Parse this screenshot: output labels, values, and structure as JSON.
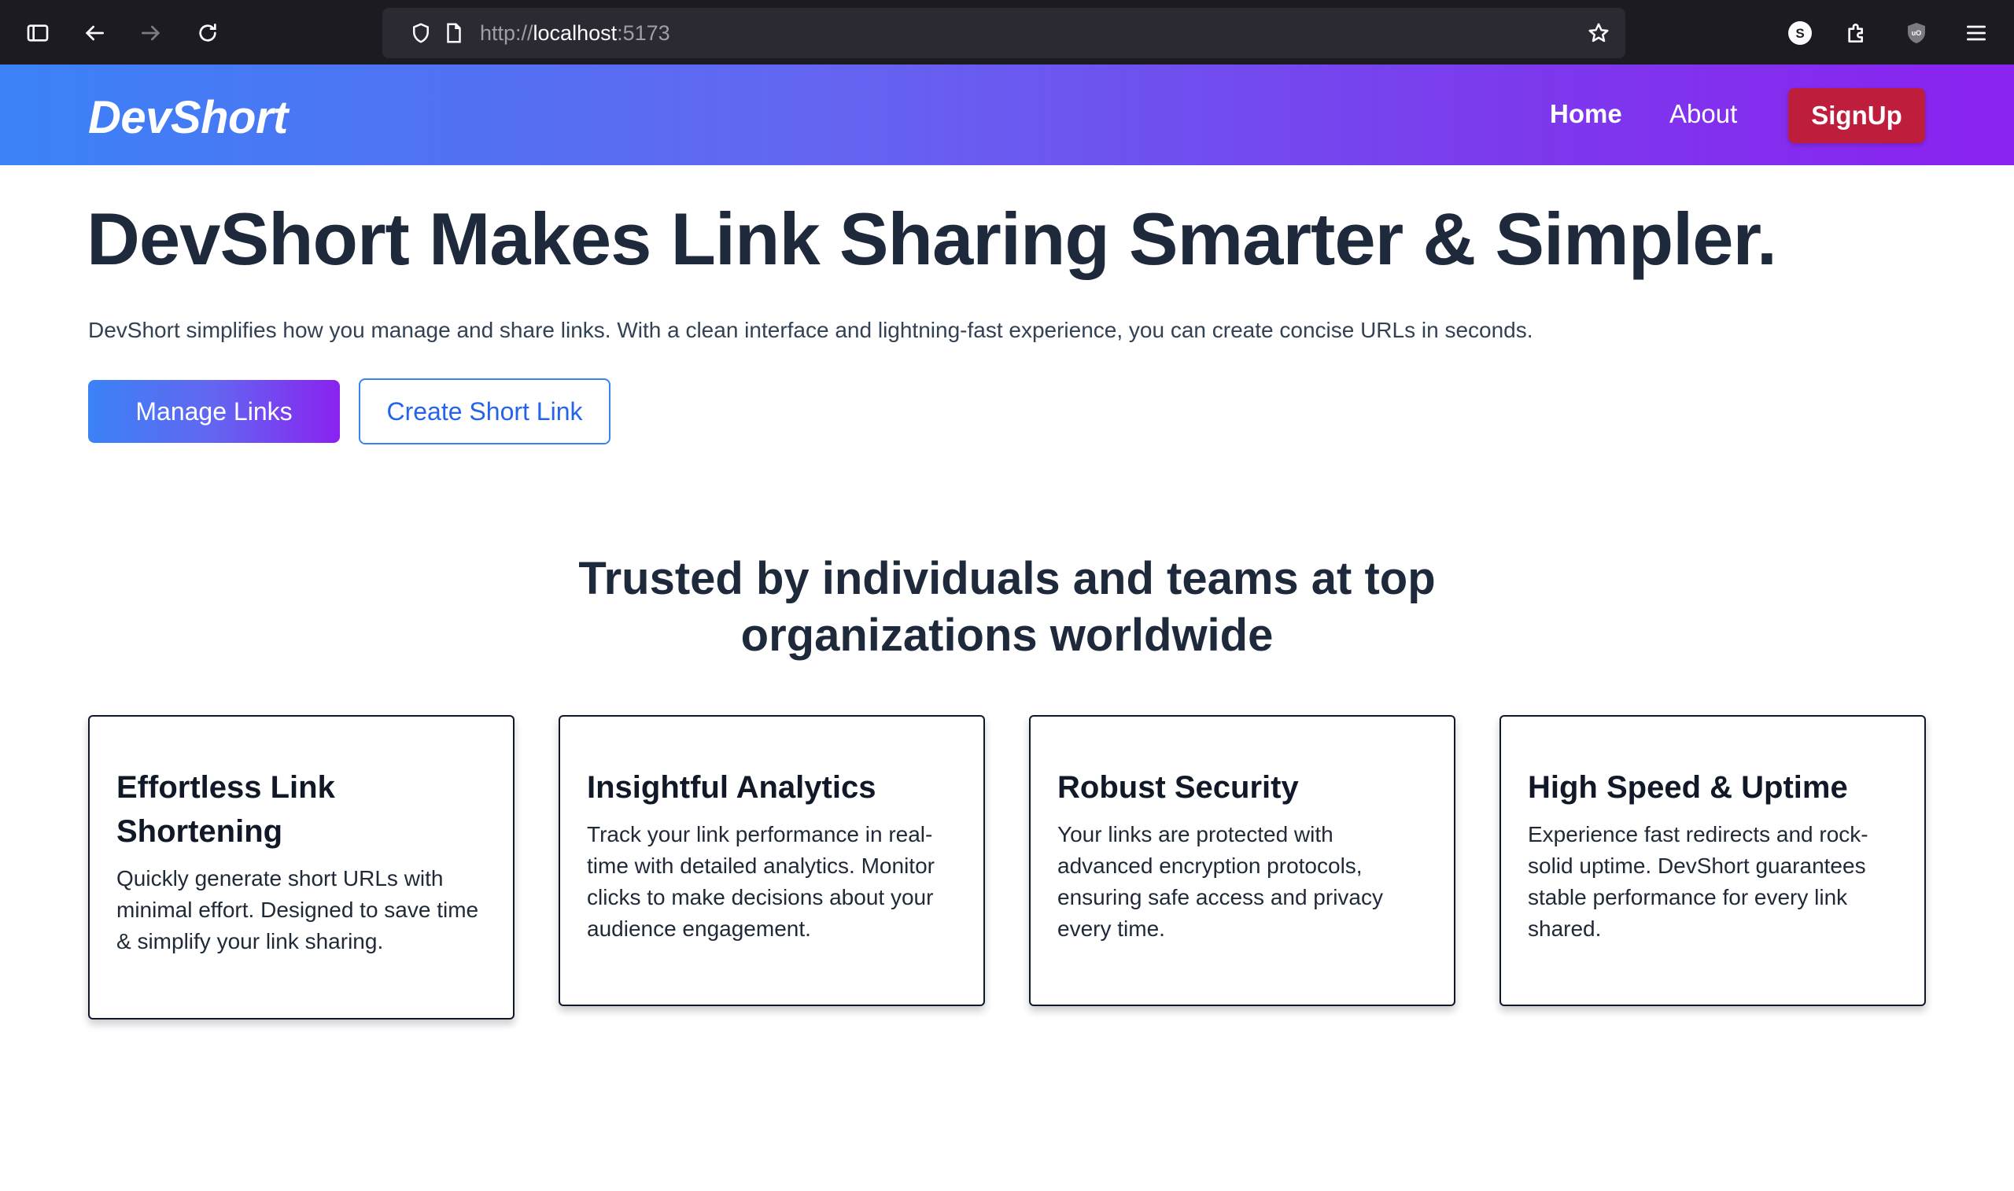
{
  "browser": {
    "url_scheme": "http://",
    "url_host": "localhost",
    "url_port": ":5173",
    "profile_initial": "S",
    "ublock_label": "uO"
  },
  "nav": {
    "logo": "DevShort",
    "links": [
      {
        "label": "Home",
        "active": true
      },
      {
        "label": "About",
        "active": false
      }
    ],
    "signup_label": "SignUp"
  },
  "hero": {
    "title": "DevShort Makes Link Sharing Smarter & Simpler.",
    "description": "DevShort simplifies how you manage and share links. With a clean interface and lightning-fast experience, you can create concise URLs in seconds.",
    "primary_button": "Manage Links",
    "secondary_button": "Create Short Link"
  },
  "trusted": {
    "line1": "Trusted by individuals and teams at top",
    "line2": "organizations worldwide"
  },
  "features": [
    {
      "title": "Effortless Link Shortening",
      "text": "Quickly generate short URLs with minimal effort. Designed to save time & simplify your link sharing."
    },
    {
      "title": "Insightful Analytics",
      "text": "Track your link performance in real-time with detailed analytics. Monitor clicks to make decisions about your audience engagement."
    },
    {
      "title": "Robust Security",
      "text": "Your links are protected with advanced encryption protocols, ensuring safe access and privacy every time."
    },
    {
      "title": "High Speed & Uptime",
      "text": "Experience fast redirects and rock-solid uptime. DevShort guarantees stable performance for every link shared."
    }
  ],
  "colors": {
    "nav_gradient_start": "#3b82f6",
    "nav_gradient_end": "#8a22f0",
    "signup_bg": "#be1e3c",
    "heading": "#1e293b",
    "outline_button": "#2563eb"
  }
}
